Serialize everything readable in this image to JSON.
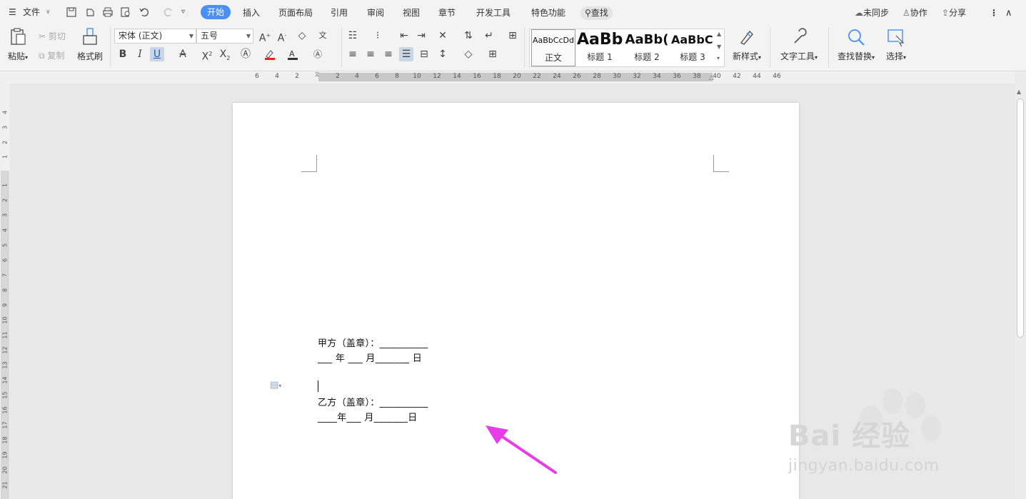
{
  "menubar": {
    "file": "文件",
    "tabs": [
      "开始",
      "插入",
      "页面布局",
      "引用",
      "审阅",
      "视图",
      "章节",
      "开发工具",
      "特色功能"
    ],
    "search": "查找",
    "sync": "未同步",
    "collab": "协作",
    "share": "分享"
  },
  "ribbon": {
    "paste": "粘贴",
    "cut": "剪切",
    "copy": "复制",
    "format_painter": "格式刷",
    "font_name": "宋体 (正文)",
    "font_size": "五号",
    "styles": [
      {
        "preview": "AaBbCcDd",
        "name": "正文"
      },
      {
        "preview": "AaBb",
        "name": "标题 1"
      },
      {
        "preview": "AaBb(",
        "name": "标题 2"
      },
      {
        "preview": "AaBbC(",
        "name": "标题 3"
      }
    ],
    "new_style": "新样式",
    "text_tools": "文字工具",
    "find_replace": "查找替换",
    "select": "选择"
  },
  "ruler": {
    "h_ticks": [
      "6",
      "4",
      "2",
      "2",
      "4",
      "6",
      "8",
      "10",
      "12",
      "14",
      "16",
      "18",
      "20",
      "22",
      "24",
      "26",
      "28",
      "30",
      "32",
      "34",
      "36",
      "38",
      "40",
      "42",
      "44",
      "46"
    ],
    "v_ticks": [
      "4",
      "3",
      "2",
      "1",
      "1",
      "2",
      "3",
      "4",
      "5",
      "6",
      "7",
      "8",
      "9",
      "10",
      "11",
      "12",
      "13",
      "14",
      "15",
      "16",
      "17",
      "18",
      "19",
      "20",
      "21"
    ]
  },
  "document": {
    "line1": "甲方（盖章）：__________",
    "line2": "___ 年 ___ 月_______ 日",
    "line3": "乙方（盖章）：__________",
    "line4": "____年___ 月_______日"
  },
  "watermark": {
    "logo": "Bai 经验",
    "url": "jingyan.baidu.com"
  },
  "colors": {
    "accent": "#4a8ff5",
    "arrow": "#e83ce8"
  }
}
